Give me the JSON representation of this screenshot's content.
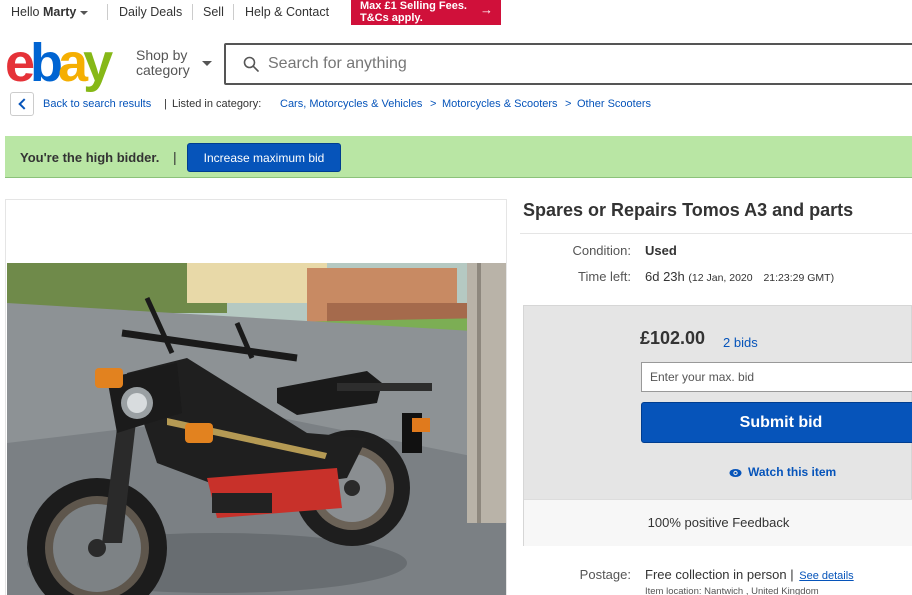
{
  "topbar": {
    "greeting": "Hello",
    "username": "Marty",
    "links": [
      "Daily Deals",
      "Sell",
      "Help & Contact"
    ],
    "promo_line1": "Max £1 Selling Fees.",
    "promo_line2": "T&Cs apply.",
    "promo_arrow": "→"
  },
  "header": {
    "logo": [
      "e",
      "b",
      "a",
      "y"
    ],
    "shop_by_line1": "Shop by",
    "shop_by_line2": "category",
    "search_placeholder": "Search for anything"
  },
  "breadcrumb": {
    "back_label": "Back to search results",
    "listed_in": "Listed in category:",
    "categories": [
      "Cars, Motorcycles & Vehicles",
      "Motorcycles & Scooters",
      "Other Scooters"
    ],
    "separator": ">",
    "pipe": "|"
  },
  "banner": {
    "message": "You're the high bidder.",
    "pipe": "|",
    "button": "Increase maximum bid"
  },
  "listing": {
    "title": "Spares or Repairs Tomos A3 and parts",
    "condition_label": "Condition:",
    "condition_value": "Used",
    "time_left_label": "Time left:",
    "time_left_value": "6d 23h",
    "end_date": "(12 Jan, 2020",
    "end_time": "21:23:29 GMT)",
    "price": "£102.00",
    "bids": "2 bids",
    "max_bid_placeholder": "Enter your max. bid",
    "submit_label": "Submit bid",
    "watch_label": "Watch this item",
    "feedback": "100% positive Feedback",
    "postage_label": "Postage:",
    "postage_value": "Free collection in person |",
    "see_details": "See details",
    "item_location": "Item location:  Nantwich , United Kingdom"
  },
  "colors": {
    "link": "#0654ba",
    "banner_bg": "#b9e6a4",
    "promo_bg": "#d0103a",
    "logo_red": "#e53238",
    "logo_blue": "#0064d2",
    "logo_yellow": "#f5af02",
    "logo_green": "#86b817"
  },
  "icons": {
    "search": "search-icon",
    "back": "chevron-left-icon",
    "watch": "eye-icon"
  }
}
